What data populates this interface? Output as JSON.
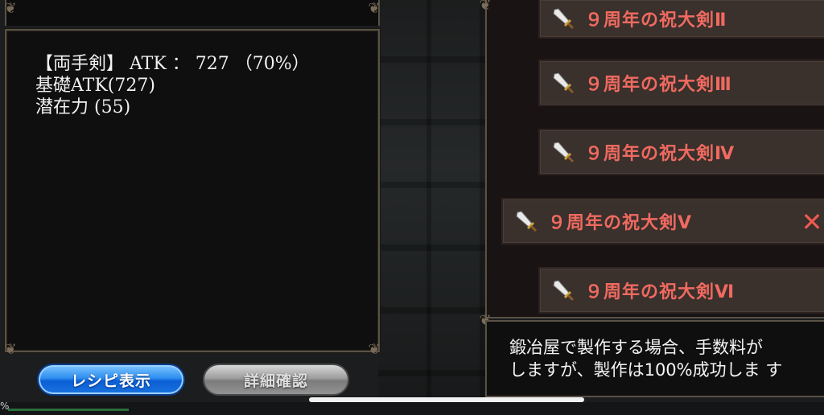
{
  "info": {
    "line1": "【両手剣】 ATK ： 727 （70%）",
    "line2": "基礎ATK(727)",
    "line3": "潜在力 (55)"
  },
  "buttons": {
    "recipe": "レシピ表示",
    "detail": "詳細確認"
  },
  "recipes": [
    {
      "label": "９周年の祝大剣Ⅱ",
      "selected": false
    },
    {
      "label": "９周年の祝大剣Ⅲ",
      "selected": false
    },
    {
      "label": "９周年の祝大剣Ⅳ",
      "selected": false
    },
    {
      "label": "９周年の祝大剣Ⅴ",
      "selected": true
    },
    {
      "label": "９周年の祝大剣Ⅵ",
      "selected": false
    }
  ],
  "close_symbol": "✕",
  "message": {
    "line1": "鍛冶屋で製作する場合、手数料が",
    "line2": "しますが、製作は100%成功しま す"
  },
  "status": {
    "percent_label": "%"
  },
  "colors": {
    "item_text": "#ef6a60",
    "recipe_button": "#1a73e0",
    "detail_button": "#939393"
  },
  "icons": {
    "item": "sword-icon",
    "close": "close-icon"
  }
}
